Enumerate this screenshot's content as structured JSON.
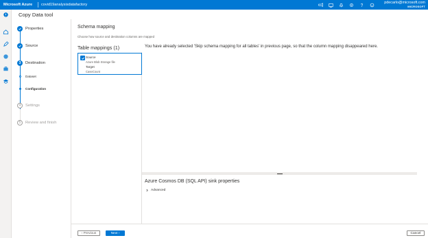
{
  "topbar": {
    "brand": "Microsoft Azure",
    "factory": "covid19analysisdatafactory",
    "icons": [
      "feedback-icon",
      "directory-icon",
      "notifications-icon",
      "settings-icon",
      "help-icon",
      "smile-icon"
    ],
    "user_email": "pdecarlo@microsoft.com",
    "user_org": "MICROSOFT"
  },
  "tool_title": "Copy Data tool",
  "steps": {
    "properties": "Properties",
    "source": "Source",
    "destination": "Destination",
    "dataset": "Dataset",
    "configuration": "Configuration",
    "settings": "Settings",
    "review": "Review and finish",
    "destination_num": "3",
    "settings_num": "4",
    "review_num": "5"
  },
  "main": {
    "title": "Schema mapping",
    "description": "Choose how source and destination columns are mapped",
    "table_mappings_label": "Table mappings (1)",
    "mapping": {
      "source_label": "Source",
      "source_value": "Azure Blob Storage file",
      "target_label": "Target",
      "target_value": "CaseCount"
    },
    "message": "You have already selected 'Skip schema mapping for all tables' in previous page, so that the column mapping disappeared here.",
    "sink_title": "Azure Cosmos DB (SQL API) sink properties",
    "advanced_label": "Advanced"
  },
  "footer": {
    "previous": "‹ Previous",
    "next": "Next ›",
    "cancel": "Cancel"
  }
}
